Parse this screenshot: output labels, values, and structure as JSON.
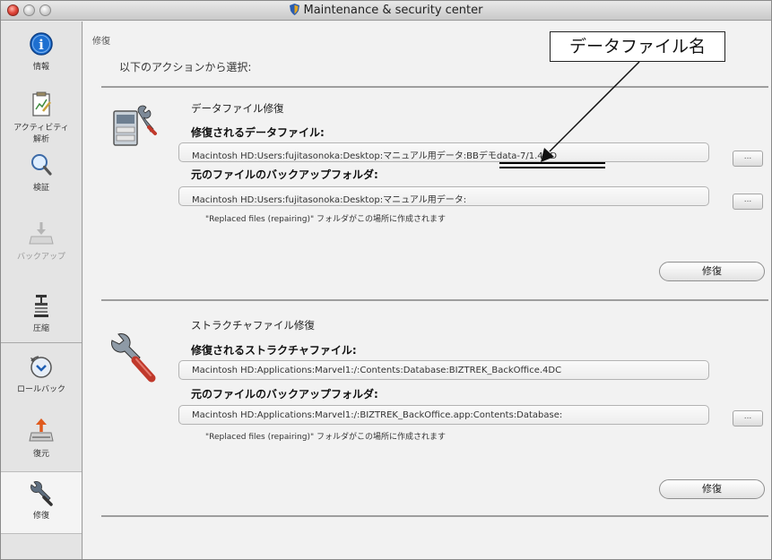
{
  "window": {
    "title": "Maintenance & security center"
  },
  "sidebar": {
    "items": [
      {
        "label": "情報",
        "icon": "info-icon"
      },
      {
        "label": "アクティビティ",
        "label2": "解析",
        "icon": "activity-analysis-icon"
      },
      {
        "label": "検証",
        "icon": "magnifier-icon"
      },
      {
        "label": "バックアップ",
        "icon": "backup-icon",
        "disabled": true
      },
      {
        "label": "圧縮",
        "icon": "compact-icon"
      },
      {
        "label": "ロールバック",
        "icon": "rollback-icon"
      },
      {
        "label": "復元",
        "icon": "restore-icon"
      },
      {
        "label": "修復",
        "icon": "repair-wrench-icon",
        "selected": true
      }
    ]
  },
  "main": {
    "breadcrumb": "修復",
    "prompt": "以下のアクションから選択:",
    "data_repair": {
      "title": "データファイル修復",
      "file_label": "修復されるデータファイル:",
      "file_path": "Macintosh HD:Users:fujitasonoka:Desktop:マニュアル用データ:BBデモdata-7/1.4DD",
      "backup_label": "元のファイルのバックアップフォルダ:",
      "backup_path": "Macintosh HD:Users:fujitasonoka:Desktop:マニュアル用データ:",
      "note": "\"Replaced files (repairing)\" フォルダがこの場所に作成されます",
      "browse_label": "...",
      "repair_button": "修復"
    },
    "structure_repair": {
      "title": "ストラクチャファイル修復",
      "file_label": "修復されるストラクチャファイル:",
      "file_path": "Macintosh HD:Applications:Marvel1:/:Contents:Database:BIZTREK_BackOffice.4DC",
      "backup_label": "元のファイルのバックアップフォルダ:",
      "backup_path": "Macintosh HD:Applications:Marvel1:/:BIZTREK_BackOffice.app:Contents:Database:",
      "note": "\"Replaced files (repairing)\" フォルダがこの場所に作成されます",
      "browse_label": "...",
      "repair_button": "修復"
    }
  },
  "annotation": {
    "callout": "データファイル名"
  }
}
